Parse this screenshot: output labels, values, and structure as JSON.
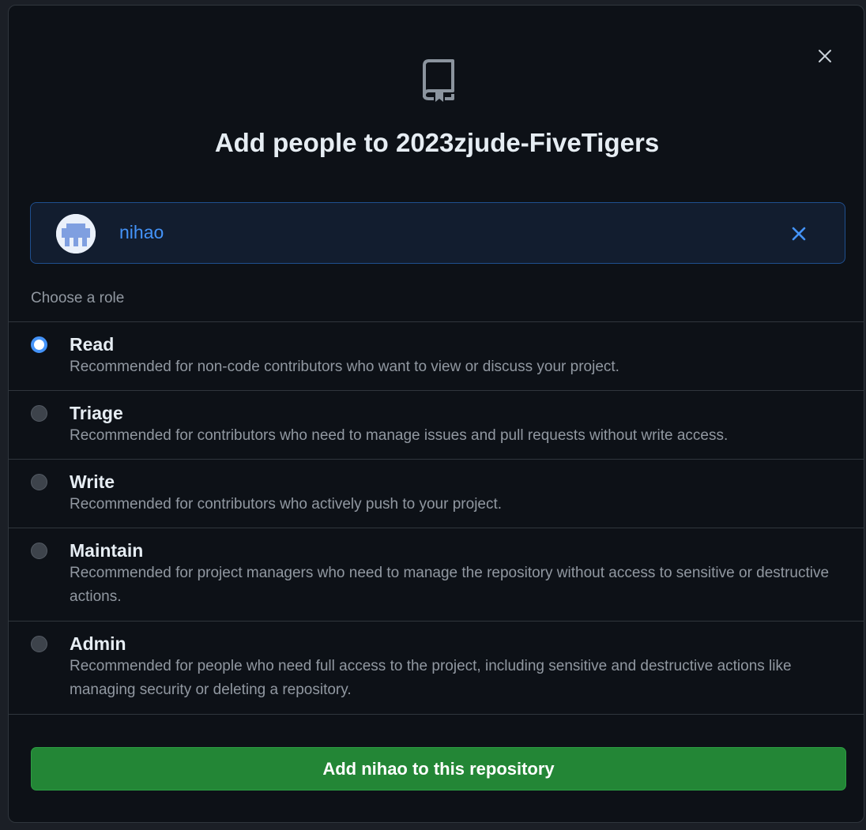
{
  "dialog": {
    "title_prefix": "Add people to ",
    "repo_name": "2023zjude-FiveTigers",
    "close_icon": "close-icon",
    "header_icon": "repo-icon"
  },
  "selected_user": {
    "username": "nihao",
    "avatar": "identicon-avatar",
    "remove_icon": "close-icon",
    "accent": "#4493f8"
  },
  "roles": {
    "heading": "Choose a role",
    "selected": "Read",
    "items": [
      {
        "name": "Read",
        "description": "Recommended for non-code contributors who want to view or discuss your project."
      },
      {
        "name": "Triage",
        "description": "Recommended for contributors who need to manage issues and pull requests without write access."
      },
      {
        "name": "Write",
        "description": "Recommended for contributors who actively push to your project."
      },
      {
        "name": "Maintain",
        "description": "Recommended for project managers who need to manage the repository without access to sensitive or destructive actions."
      },
      {
        "name": "Admin",
        "description": "Recommended for people who need full access to the project, including sensitive and destructive actions like managing security or deleting a repository."
      }
    ]
  },
  "submit": {
    "label": "Add nihao to this repository",
    "color": "#238636"
  }
}
